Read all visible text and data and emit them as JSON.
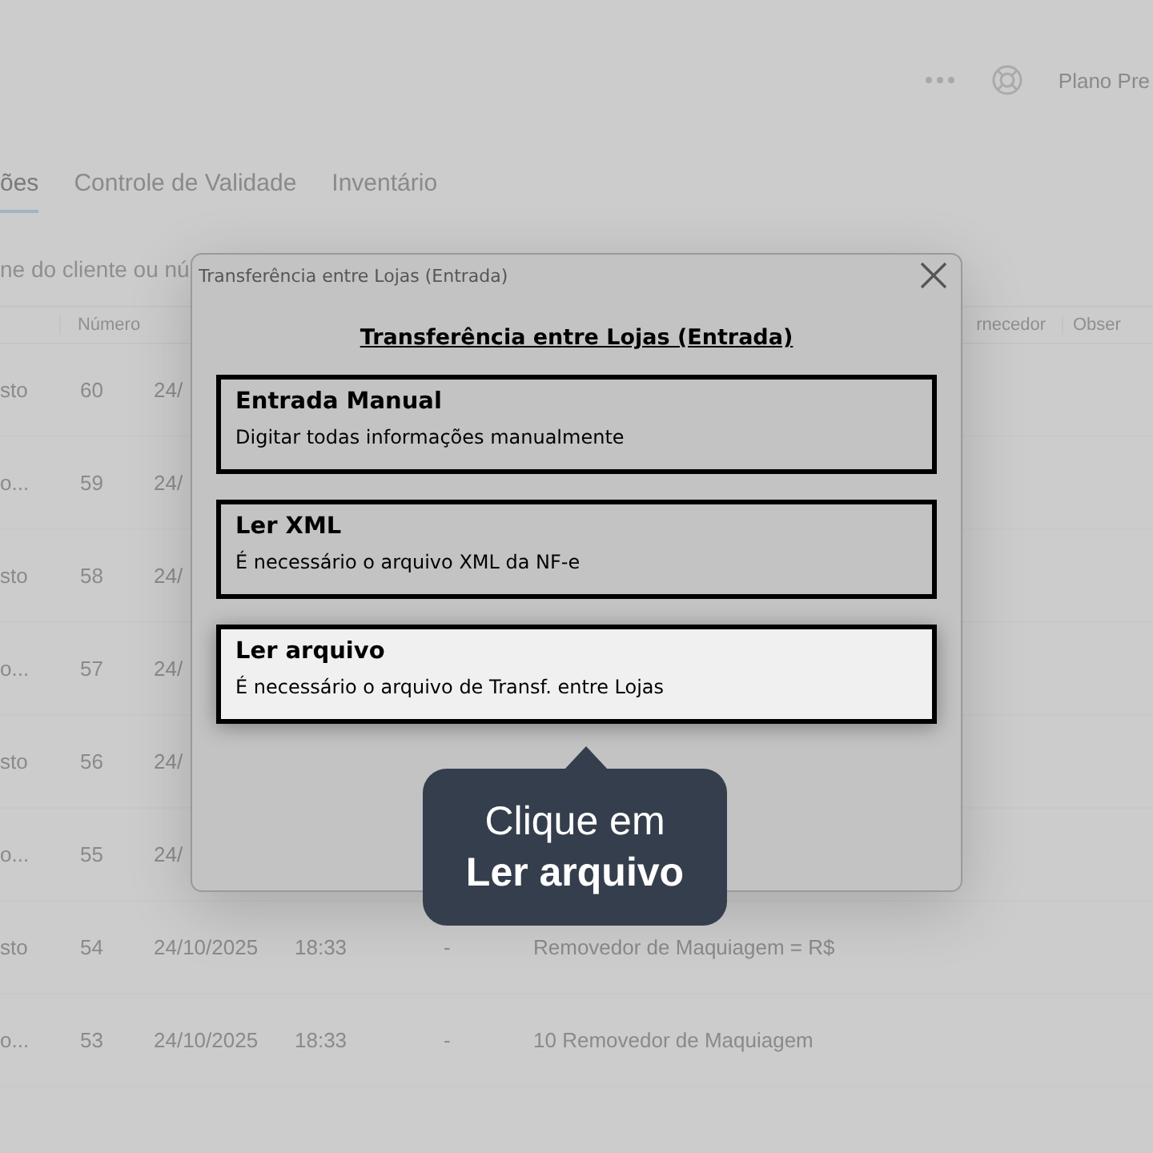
{
  "header": {
    "plan": "Plano Pre"
  },
  "tabs": [
    {
      "label": "ões",
      "selected": true
    },
    {
      "label": "Controle de Validade",
      "selected": false
    },
    {
      "label": "Inventário",
      "selected": false
    }
  ],
  "search": {
    "placeholder": "ne do cliente ou nú"
  },
  "table": {
    "columns": [
      "Número",
      "rnecedor",
      "Obser"
    ],
    "rows": [
      {
        "column_1": "sto",
        "number": "60",
        "date": "24/"
      },
      {
        "column_1": "o...",
        "number": "59",
        "date": "24/"
      },
      {
        "column_1": "sto",
        "number": "58",
        "date": "24/"
      },
      {
        "column_1": "o...",
        "number": "57",
        "date": "24/"
      },
      {
        "column_1": "sto",
        "number": "56",
        "date": "24/"
      },
      {
        "column_1": "o...",
        "number": "55",
        "date": "24/"
      },
      {
        "column_1": "sto",
        "number": "54",
        "date": "24/10/2025",
        "time": "18:33",
        "column_5": "-",
        "description": "Removedor de Maquiagem = R$"
      },
      {
        "column_1": "o...",
        "number": "53",
        "date": "24/10/2025",
        "time": "18:33",
        "column_5": "-",
        "description": "10  Removedor de Maquiagem"
      }
    ]
  },
  "dialog": {
    "title": "Transferência entre Lojas (Entrada)",
    "heading": "Transferência entre Lojas (Entrada)",
    "options": [
      {
        "title": "Entrada Manual",
        "description": "Digitar todas informações manualmente",
        "selected": false
      },
      {
        "title": "Ler XML",
        "description": "É necessário o arquivo XML da NF-e",
        "selected": false
      },
      {
        "title": "Ler arquivo",
        "description": "É necessário o arquivo de Transf. entre Lojas",
        "selected": true
      }
    ]
  },
  "tooltip": {
    "text": "Clique em",
    "emphasis": "Ler arquivo"
  }
}
